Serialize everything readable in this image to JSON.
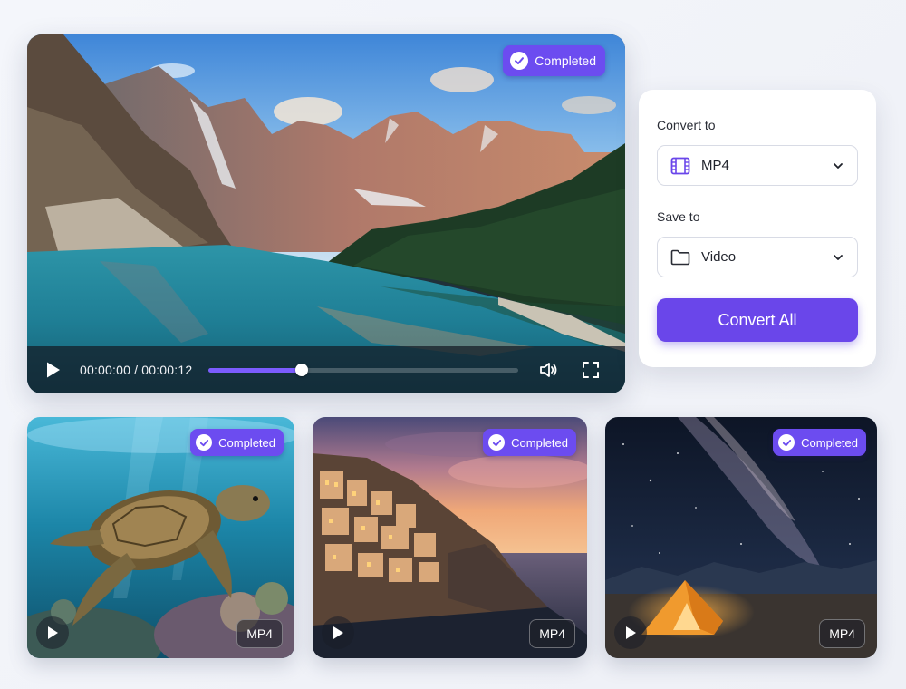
{
  "main_video": {
    "status": "Completed",
    "current_time": "00:00:00",
    "separator": "/",
    "duration": "00:00:12",
    "progress": 0.3
  },
  "panel": {
    "convert_label": "Convert to",
    "format_value": "MP4",
    "save_label": "Save to",
    "folder_value": "Video",
    "convert_button": "Convert All"
  },
  "thumbnails": [
    {
      "status": "Completed",
      "format": "MP4",
      "scene": "sea-turtle"
    },
    {
      "status": "Completed",
      "format": "MP4",
      "scene": "coastal-village-sunset"
    },
    {
      "status": "Completed",
      "format": "MP4",
      "scene": "milky-way-tent"
    }
  ],
  "colors": {
    "accent": "#6a46ea",
    "badge": "#6c4cf0",
    "progress": "#7b5cff"
  },
  "icons": [
    "play-icon",
    "volume-icon",
    "fullscreen-icon",
    "check-icon",
    "film-icon",
    "folder-icon",
    "chevron-down-icon"
  ]
}
